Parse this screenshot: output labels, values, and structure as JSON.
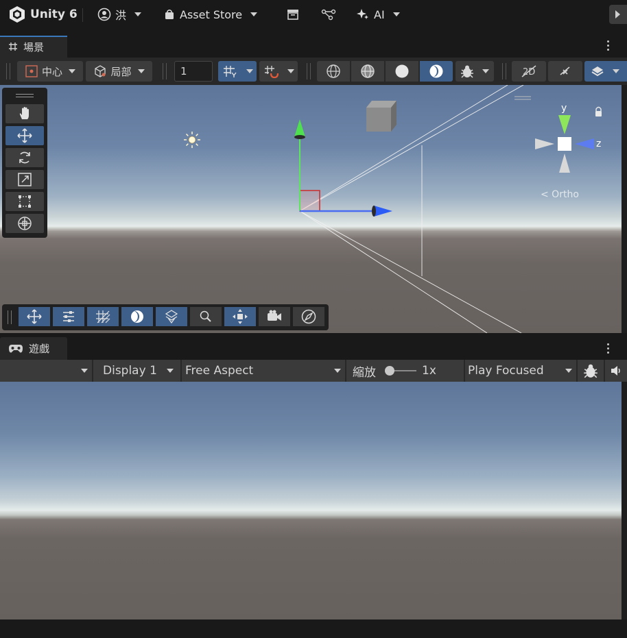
{
  "titlebar": {
    "app_name": "Unity 6",
    "account": "洪",
    "asset_store": "Asset Store",
    "ai": "AI"
  },
  "scene": {
    "tab_label": "場景",
    "pivot_label": "中心",
    "space_label": "局部",
    "grid_size": "1",
    "gizmo_axes": {
      "y": "y",
      "z": "z"
    },
    "persp_label": "< Ortho"
  },
  "game": {
    "tab_label": "遊戲",
    "display": "Display 1",
    "aspect": "Free Aspect",
    "scale_label": "縮放",
    "scale_value": "1x",
    "play_mode": "Play Focused"
  },
  "colors": {
    "accent_blue": "#3e5f8a",
    "toolbar_bg": "#282828",
    "titlebar_bg": "#191919"
  },
  "icons": {
    "tools": [
      "hand-icon",
      "move-icon",
      "rotate-icon",
      "scale-icon",
      "rect-icon",
      "transform-icon"
    ],
    "overlay": [
      "move-icon",
      "sliders-icon",
      "grid-snap-icon",
      "shading-icon",
      "layers-icon",
      "search-icon",
      "pivot-icon",
      "camera-icon",
      "compass-icon"
    ]
  }
}
